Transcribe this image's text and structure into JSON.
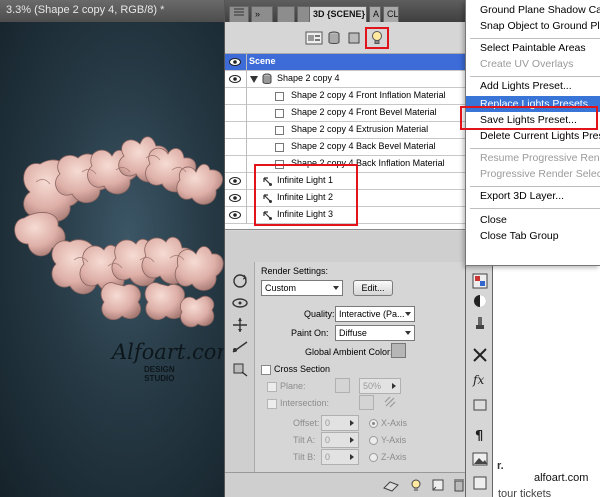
{
  "document": {
    "title": "3.3% (Shape 2 copy 4, RGB/8) *",
    "watermark": "Alfoart.com",
    "watermark_sub_line1": "DESIGN",
    "watermark_sub_line2": "STUDIO"
  },
  "panel": {
    "tabs": [
      {
        "label": "3D {SCENE}",
        "active": true
      },
      {
        "label": "A"
      },
      {
        "label": "CL"
      }
    ],
    "scene_items": [
      {
        "label": "Scene",
        "type": "root",
        "selected": true
      },
      {
        "label": "Shape 2 copy 4",
        "type": "mesh",
        "expanded": true
      },
      {
        "label": "Shape 2 copy 4 Front Inflation Material",
        "type": "material"
      },
      {
        "label": "Shape 2 copy 4 Front Bevel Material",
        "type": "material"
      },
      {
        "label": "Shape 2 copy 4 Extrusion Material",
        "type": "material"
      },
      {
        "label": "Shape 2 copy 4 Back Bevel Material",
        "type": "material"
      },
      {
        "label": "Shape 2 copy 4 Back Inflation Material",
        "type": "material"
      },
      {
        "label": "Infinite Light 1",
        "type": "light"
      },
      {
        "label": "Infinite Light 2",
        "type": "light"
      },
      {
        "label": "Infinite Light 3",
        "type": "light"
      }
    ],
    "render": {
      "settings_label": "Render Settings:",
      "preset_value": "Custom",
      "edit_button": "Edit...",
      "quality_label": "Quality:",
      "quality_value": "Interactive (Pa...",
      "paint_on_label": "Paint On:",
      "paint_on_value": "Diffuse",
      "ambient_label": "Global Ambient Color:",
      "cross_section_label": "Cross Section",
      "plane_label": "Plane:",
      "plane_opacity": "50%",
      "intersection_label": "Intersection:",
      "offset_label": "Offset:",
      "offset_value": "0",
      "tilt_a_label": "Tilt A:",
      "tilt_a_value": "0",
      "tilt_b_label": "Tilt B:",
      "tilt_b_value": "0",
      "x_axis": "X-Axis",
      "y_axis": "Y-Axis",
      "z_axis": "Z-Axis"
    }
  },
  "menu": {
    "items": [
      {
        "label": "Ground Plane Shadow Catcher",
        "enabled": true
      },
      {
        "label": "Snap Object to Ground Plane",
        "enabled": true
      },
      {
        "separator": true
      },
      {
        "label": "Select Paintable Areas",
        "enabled": true
      },
      {
        "label": "Create UV Overlays",
        "enabled": false
      },
      {
        "separator": true
      },
      {
        "label": "Add Lights Preset...",
        "enabled": true
      },
      {
        "label": "Replace Lights Presets...",
        "enabled": true,
        "highlighted": true
      },
      {
        "label": "Save Lights Preset...",
        "enabled": true
      },
      {
        "label": "Delete Current Lights Preset",
        "enabled": true
      },
      {
        "separator": true
      },
      {
        "label": "Resume Progressive Render",
        "enabled": false
      },
      {
        "label": "Progressive Render Selection",
        "enabled": false
      },
      {
        "separator": true
      },
      {
        "label": "Export 3D Layer...",
        "enabled": true
      },
      {
        "separator": true
      },
      {
        "label": "Close",
        "enabled": true
      },
      {
        "label": "Close Tab Group",
        "enabled": true
      }
    ]
  },
  "page": {
    "site_credit": "alfoart.com",
    "bottom_text": "tour tickets",
    "side_text": "r."
  },
  "colors": {
    "highlight_border": "#e0141a",
    "selection": "#3d6bd8",
    "menu_highlight": "#3875d7"
  }
}
